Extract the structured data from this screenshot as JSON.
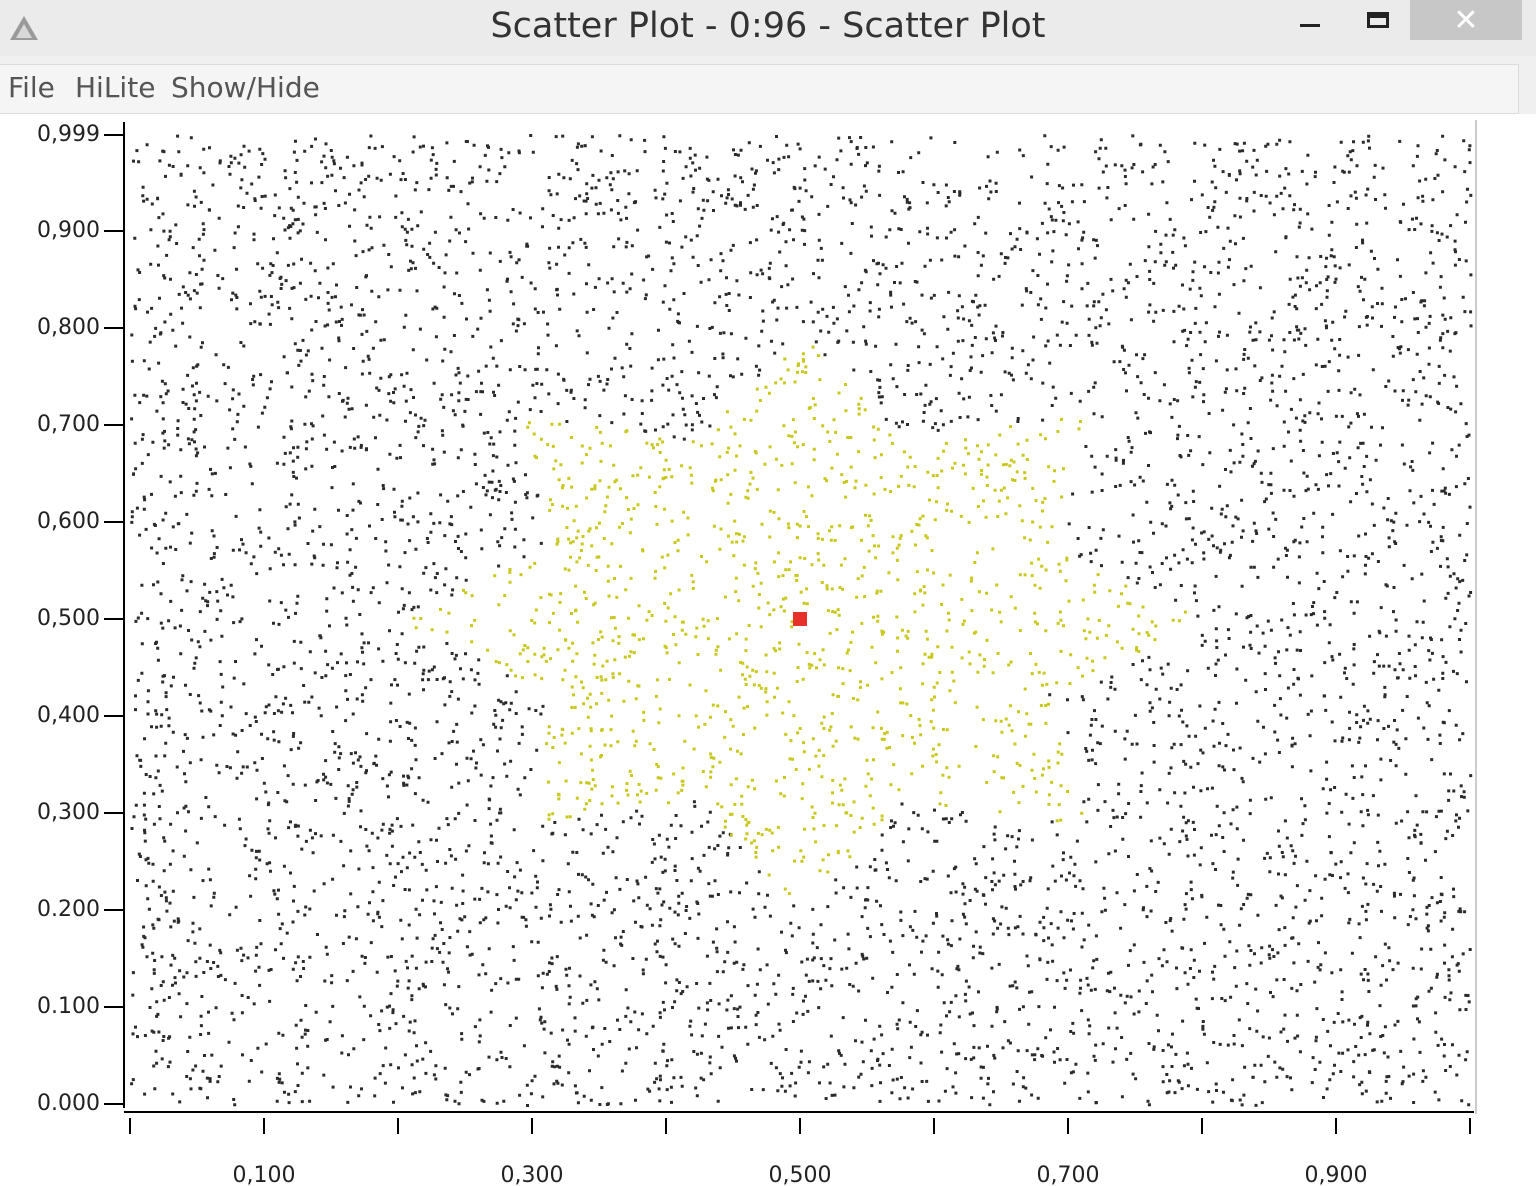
{
  "window": {
    "title": "Scatter Plot - 0:96 - Scatter Plot",
    "app_icon": "knime-triangle-icon",
    "controls": {
      "minimize_icon": "minimize-icon",
      "maximize_icon": "maximize-icon",
      "close_icon": "close-icon",
      "close_glyph": "✕"
    }
  },
  "menu": {
    "items": [
      {
        "label": "File"
      },
      {
        "label": "HiLite"
      },
      {
        "label": "Show/Hide"
      }
    ]
  },
  "chart_data": {
    "type": "scatter",
    "xlim": [
      0.0,
      1.0
    ],
    "ylim": [
      0.0,
      0.999
    ],
    "x_ticks": [
      0.0,
      0.1,
      0.2,
      0.3,
      0.4,
      0.5,
      0.6,
      0.7,
      0.8,
      0.9,
      1.0
    ],
    "x_tick_labels": [
      "0,100",
      "0,300",
      "0,500",
      "0,700",
      "0,900"
    ],
    "x_tick_label_values": [
      0.1,
      0.3,
      0.5,
      0.7,
      0.9
    ],
    "y_ticks": [
      0.0,
      0.1,
      0.2,
      0.3,
      0.4,
      0.5,
      0.6,
      0.7,
      0.8,
      0.9,
      0.999
    ],
    "y_tick_labels": [
      "0.000",
      "0.100",
      "0.200",
      "0,300",
      "0,400",
      "0,500",
      "0,600",
      "0,700",
      "0,800",
      "0,900",
      "0,999"
    ],
    "grid": false,
    "series": [
      {
        "color": "#2b2b2b",
        "region": "uniform background points over [0,1]x[0,1]"
      },
      {
        "color": "#c8c81e",
        "region": "eight-pointed star centered at (0.5, 0.5), outer radius 0.3, inner radius 0.2"
      },
      {
        "color": "#e8302a",
        "point": [
          0.5,
          0.5
        ]
      }
    ]
  }
}
